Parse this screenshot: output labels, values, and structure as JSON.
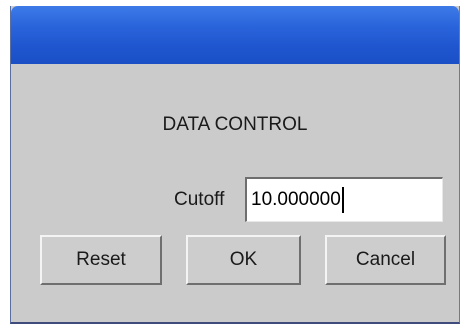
{
  "dialog": {
    "heading": "DATA CONTROL",
    "cutoff": {
      "label": "Cutoff",
      "value": "10.000000"
    },
    "buttons": {
      "reset": "Reset",
      "ok": "OK",
      "cancel": "Cancel"
    }
  },
  "colors": {
    "titlebar": "#2a64db",
    "dialog_background": "#cbcbcb"
  }
}
